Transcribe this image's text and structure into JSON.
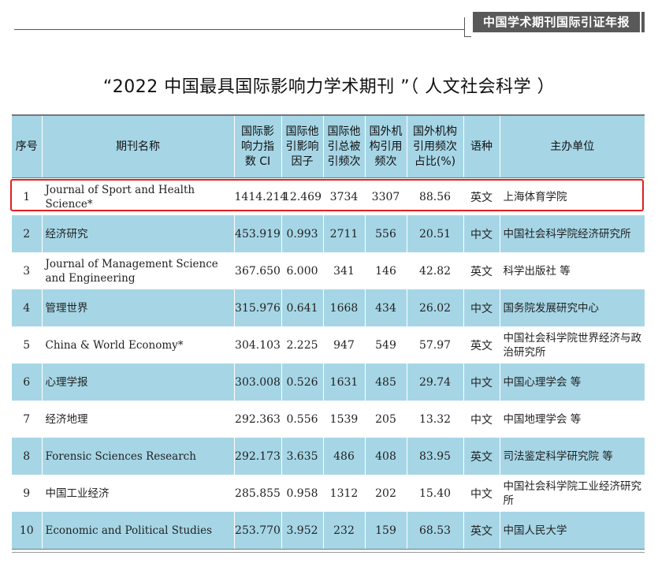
{
  "header": {
    "badge": "中国学术期刊国际引证年报"
  },
  "title": "“2022 中国最具国际影响力学术期刊 ”（ 人文社会科学 ）",
  "table": {
    "headers": [
      "序号",
      "期刊名称",
      "国际影响力指数 CI",
      "国际他引影响因子",
      "国际他引总被引频次",
      "国外机构引用频次",
      "国外机构引用频次占比(%)",
      "语种",
      "主办单位"
    ],
    "rows": [
      [
        "1",
        "Journal of Sport and Health Science*",
        "1414.214",
        "12.469",
        "3734",
        "3307",
        "88.56",
        "英文",
        "上海体育学院"
      ],
      [
        "2",
        "经济研究",
        "453.919",
        "0.993",
        "2711",
        "556",
        "20.51",
        "中文",
        "中国社会科学院经济研究所"
      ],
      [
        "3",
        "Journal of Management Science and Engineering",
        "367.650",
        "6.000",
        "341",
        "146",
        "42.82",
        "英文",
        "科学出版社 等"
      ],
      [
        "4",
        "管理世界",
        "315.976",
        "0.641",
        "1668",
        "434",
        "26.02",
        "中文",
        "国务院发展研究中心"
      ],
      [
        "5",
        "China & World Economy*",
        "304.103",
        "2.225",
        "947",
        "549",
        "57.97",
        "英文",
        "中国社会科学院世界经济与政治研究所"
      ],
      [
        "6",
        "心理学报",
        "303.008",
        "0.526",
        "1631",
        "485",
        "29.74",
        "中文",
        "中国心理学会 等"
      ],
      [
        "7",
        "经济地理",
        "292.363",
        "0.556",
        "1539",
        "205",
        "13.32",
        "中文",
        "中国地理学会 等"
      ],
      [
        "8",
        "Forensic Sciences Research",
        "292.173",
        "3.635",
        "486",
        "408",
        "83.95",
        "英文",
        "司法鉴定科学研究院 等"
      ],
      [
        "9",
        "中国工业经济",
        "285.855",
        "0.958",
        "1312",
        "202",
        "15.40",
        "中文",
        "中国社会科学院工业经济研究所"
      ],
      [
        "10",
        "Economic and Political Studies",
        "253.770",
        "3.952",
        "232",
        "159",
        "68.53",
        "英文",
        "中国人民大学"
      ]
    ]
  },
  "highlight_color": "#e02020",
  "row_band_color": "#a6d6e6"
}
